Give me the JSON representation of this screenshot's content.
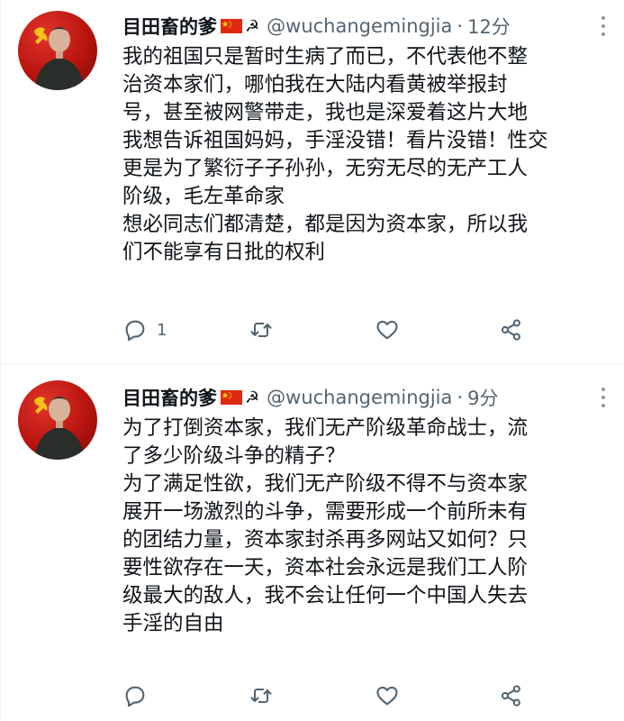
{
  "tweets": [
    {
      "display_name": "目田畜的爹",
      "handle": "@wuchangemingjia",
      "separator": "·",
      "time": "12分",
      "flag_icon": "china-flag-icon",
      "emblem_icon": "hammer-sickle-icon",
      "emblem_glyph": "☭",
      "lines": [
        "我的祖国只是暂时生病了而已，不代表他不整",
        "治资本家们，哪怕我在大陆内看黄被举报封",
        "号，甚至被网警带走，我也是深爱着这片大地",
        "我想告诉祖国妈妈，手淫没错！看片没错！性交",
        "更是为了繁衍子子孙孙，无穷无尽的无产工人",
        "阶级，毛左革命家",
        "想必同志们都清楚，都是因为资本家，所以我",
        "们不能享有日批的权利"
      ],
      "actions": {
        "reply_count": "1",
        "retweet_count": "",
        "like_count": ""
      }
    },
    {
      "display_name": "目田畜的爹",
      "handle": "@wuchangemingjia",
      "separator": "·",
      "time": "9分",
      "flag_icon": "china-flag-icon",
      "emblem_icon": "hammer-sickle-icon",
      "emblem_glyph": "☭",
      "lines": [
        "为了打倒资本家，我们无产阶级革命战士，流",
        "了多少阶级斗争的精子？",
        "为了满足性欲，我们无产阶级不得不与资本家",
        "展开一场激烈的斗争，需要形成一个前所未有",
        "的团结力量，资本家封杀再多网站又如何？只",
        "要性欲存在一天，资本社会永远是我们工人阶",
        "级最大的敌人，我不会让任何一个中国人失去",
        "手淫的自由"
      ],
      "actions": {
        "reply_count": "",
        "retweet_count": "",
        "like_count": ""
      }
    }
  ],
  "colors": {
    "text": "#0f1419",
    "secondary": "#536471",
    "icon": "#536471",
    "avatar_red": "#c8170f",
    "flag_red": "#de2910",
    "flag_yellow": "#ffde00"
  }
}
